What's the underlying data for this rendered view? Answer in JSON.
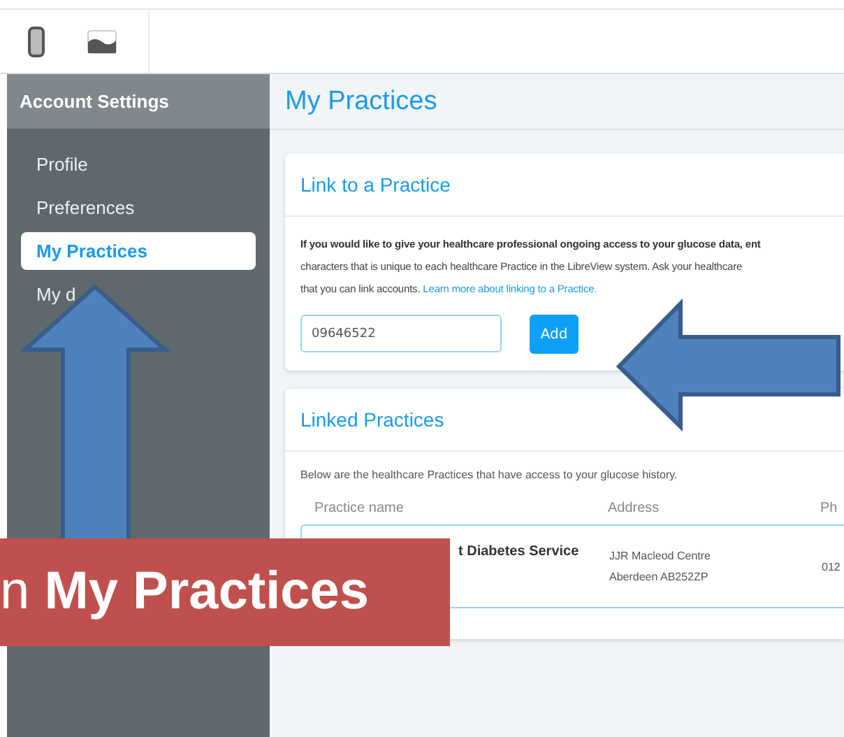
{
  "sidebar": {
    "title": "Account Settings",
    "items": [
      {
        "label": "Profile",
        "selected": false
      },
      {
        "label": "Preferences",
        "selected": false
      },
      {
        "label": "My Practices",
        "selected": true
      },
      {
        "label": "My d",
        "selected": false
      }
    ]
  },
  "page_title": "My Practices",
  "link_card": {
    "title": "Link to a Practice",
    "lines": [
      "**If you would like to give your healthcare professional ongoing access to your glucose data, ent**",
      "characters that is unique to each healthcare Practice in the LibreView system. Ask your healthcare",
      "that you can link accounts."
    ],
    "link": "Learn more about linking to a Practice.",
    "input": {
      "value": "09646522"
    },
    "button": "Add"
  },
  "linked_card": {
    "title": "Linked Practices",
    "description": "Below are the healthcare Practices that have access to your glucose history.",
    "columns": [
      "Practice name",
      "Address",
      "Ph"
    ],
    "rows": [
      {
        "name": "t Diabetes Service",
        "address": [
          "JJR Macleod Centre",
          "Aberdeen AB252ZP"
        ],
        "phone": "012"
      }
    ]
  },
  "banner": "n **My Practices**"
}
